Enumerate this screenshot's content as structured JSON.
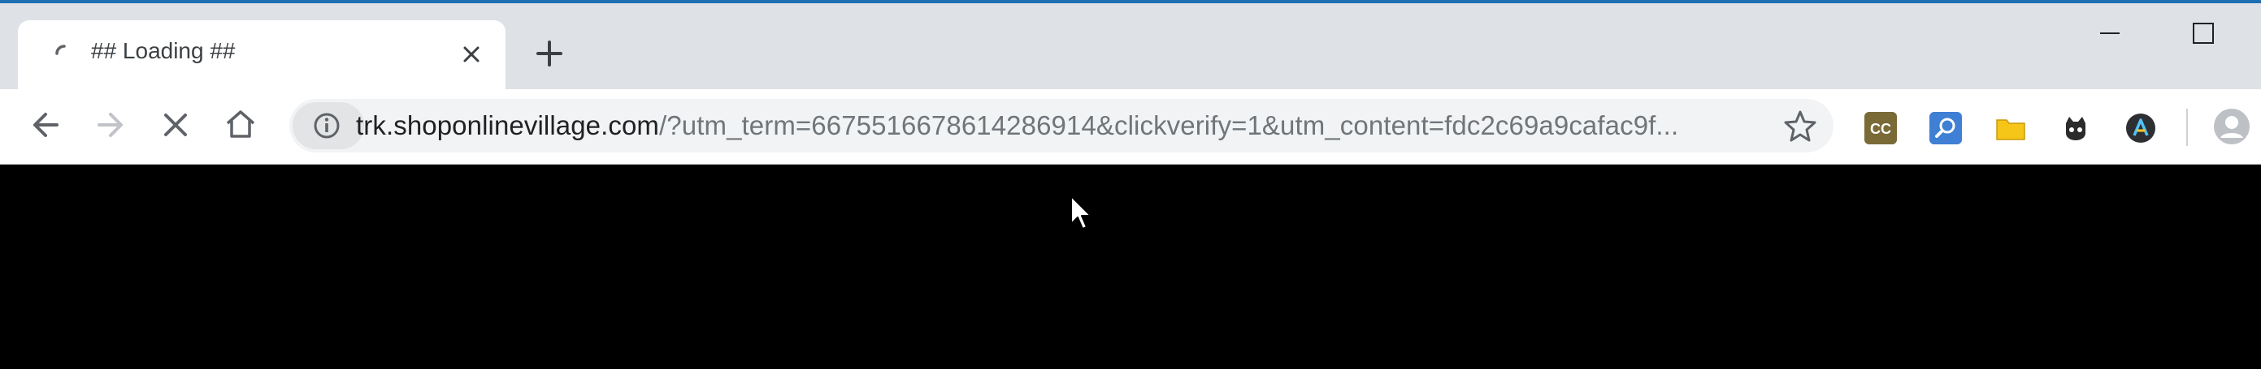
{
  "tab": {
    "title": "## Loading ##",
    "spinner_icon": "loading-spinner-icon",
    "close_icon": "close-icon"
  },
  "tabstrip": {
    "new_tab_icon": "plus-icon"
  },
  "window_controls": {
    "minimize_icon": "minimize-icon",
    "maximize_icon": "maximize-icon"
  },
  "toolbar": {
    "back_icon": "back-arrow-icon",
    "forward_icon": "forward-arrow-icon",
    "stop_icon": "stop-x-icon",
    "home_icon": "home-icon"
  },
  "omnibox": {
    "info_icon": "info-icon",
    "url_host": "trk.shoponlinevillage.com",
    "url_path": "/?utm_term=6675516678614286914&clickverify=1&utm_content=fdc2c69a9cafac9f...",
    "bookmark_icon": "star-icon"
  },
  "extensions": [
    {
      "name": "cc-extension-icon"
    },
    {
      "name": "search-extension-icon"
    },
    {
      "name": "folder-extension-icon"
    },
    {
      "name": "cat-extension-icon"
    },
    {
      "name": "a-extension-icon"
    }
  ],
  "profile_icon": "profile-avatar-icon",
  "colors": {
    "tabstrip_bg": "#dee1e6",
    "toolbar_bg": "#ffffff",
    "omnibox_bg": "#f1f3f4",
    "content_bg": "#000000"
  }
}
